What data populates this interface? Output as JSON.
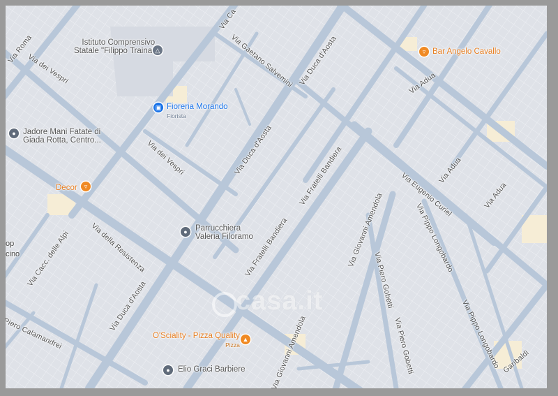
{
  "colors": {
    "background": "#e9ebef",
    "block": "#dfe2e8",
    "road": "#b8c7d9",
    "road_major": "#aebfd4",
    "poi_food": "#f08a24",
    "poi_shop": "#1a73e8",
    "poi_generic": "#606b7a",
    "school_icon": "#5f6b7a"
  },
  "streets": [
    {
      "text": "Via Roma"
    },
    {
      "text": "Via dei Vespri"
    },
    {
      "text": "Via dei Vespri"
    },
    {
      "text": "Via Ca"
    },
    {
      "text": "Via Gaetano Salvemini"
    },
    {
      "text": "Via Duca d'Aosta"
    },
    {
      "text": "Via Duca d'Aosta"
    },
    {
      "text": "Via Duca d'Aosta"
    },
    {
      "text": "Via Fratelli Bandiera"
    },
    {
      "text": "Via Fratelli Bandiera"
    },
    {
      "text": "Via Adua"
    },
    {
      "text": "Via Adua"
    },
    {
      "text": "Via Adua"
    },
    {
      "text": "Via Eugenio Curiel"
    },
    {
      "text": "Via Giovanni Amendola"
    },
    {
      "text": "Via Giovanni Amendola"
    },
    {
      "text": "Via Pippo Longobardo"
    },
    {
      "text": "Via Pippo Longobardo"
    },
    {
      "text": "Via Piero Gobetti"
    },
    {
      "text": "Via Piero Gobetti"
    },
    {
      "text": "Via della Resistenza"
    },
    {
      "text": "Via Cacc. delle Alpi"
    },
    {
      "text": "Piero Calamandrei"
    },
    {
      "text": "Garibaldi"
    }
  ],
  "pois": [
    {
      "name": "Istituto Comprensivo",
      "name2": "Statale \"Filippo Traina\"",
      "icon": "school-icon"
    },
    {
      "name": "Fioreria Morando",
      "sub": "Fiorista",
      "icon": "shopping-bag-icon"
    },
    {
      "name": "Bar Angelo Cavallo",
      "icon": "cocktail-icon"
    },
    {
      "name": "Jadore Mani Fatate di",
      "name2": "Giada Rotta, Centro...",
      "icon": "place-icon"
    },
    {
      "name": "Decor",
      "icon": "cocktail-icon"
    },
    {
      "name": "Parrucchiera",
      "name2": "Valeria Filoramo",
      "icon": "place-icon"
    },
    {
      "name": "O'Sciality - Pizza Quality",
      "sub": "Pizza",
      "icon": "pizza-icon"
    },
    {
      "name": "Elio Graci Barbiere",
      "icon": "place-icon"
    }
  ],
  "edge_fragments": [
    {
      "text": "op"
    },
    {
      "text": "cino"
    }
  ],
  "watermark": "casa.it"
}
